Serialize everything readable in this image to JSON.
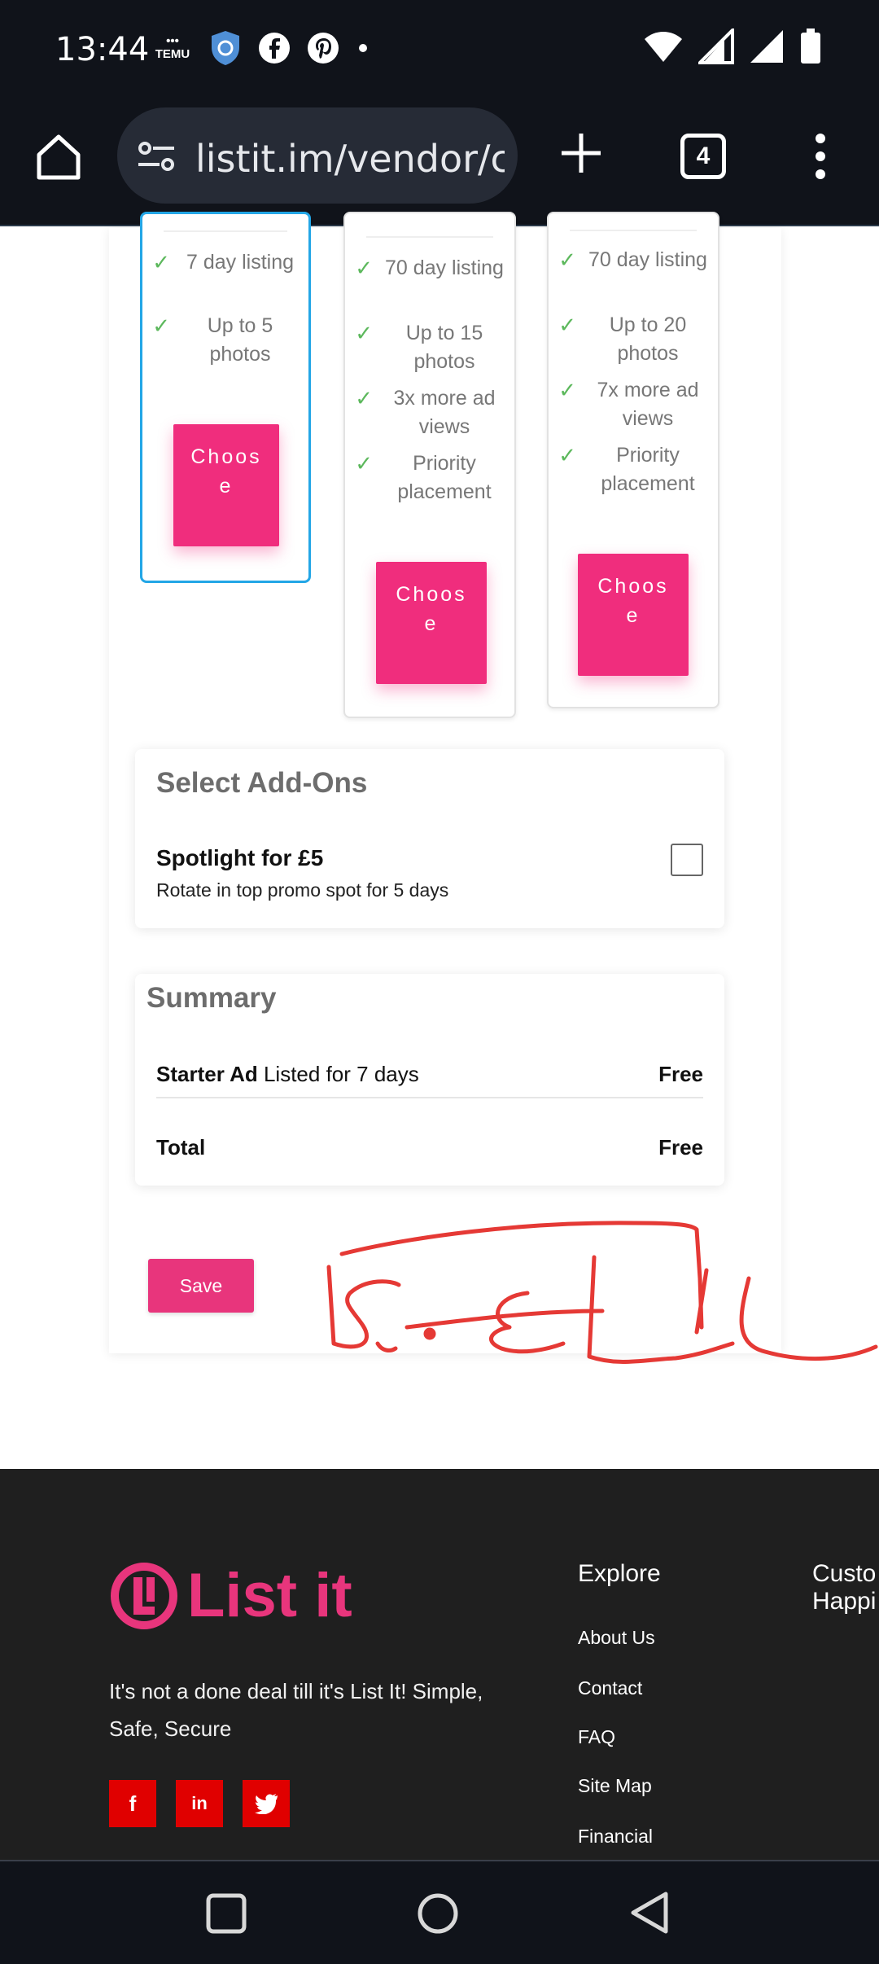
{
  "status_bar": {
    "time": "13:44",
    "temu_badge": "TEMU",
    "icons_left": [
      "temu-icon",
      "shield-icon",
      "facebook-icon",
      "pinterest-icon",
      "dot-icon"
    ],
    "icons_right": [
      "wifi-icon",
      "signal-icon",
      "signal-icon-2",
      "battery-icon"
    ]
  },
  "browser": {
    "url": "listit.im/vendor/c",
    "tab_count": "4"
  },
  "plans": [
    {
      "features": [
        "7 day listing",
        "Up to 5 photos"
      ],
      "button": "Choose",
      "selected": true
    },
    {
      "features": [
        "70 day listing",
        "Up to 15 photos",
        "3x more ad views",
        "Priority placement"
      ],
      "button": "Choose",
      "selected": false
    },
    {
      "features": [
        "70 day listing",
        "Up to 20 photos",
        "7x more ad views",
        "Priority placement"
      ],
      "button": "Choose",
      "selected": false
    }
  ],
  "addons": {
    "title": "Select Add-Ons",
    "spotlight_title": "Spotlight for £5",
    "spotlight_desc": "Rotate in top promo spot for 5 days",
    "spotlight_checked": false
  },
  "summary": {
    "title": "Summary",
    "item_name": "Starter Ad",
    "item_desc": "Listed for 7 days",
    "item_price": "Free",
    "total_label": "Total",
    "total_value": "Free"
  },
  "save_label": "Save",
  "annotation_text": "SELL",
  "footer": {
    "logo_text": "List it",
    "tagline": "It's not a done deal till it's List It! Simple, Safe, Secure",
    "socials": [
      "f",
      "in",
      "t"
    ],
    "explore_heading": "Explore",
    "explore_links": [
      "About Us",
      "Contact",
      "FAQ",
      "Site Map",
      "Financial"
    ],
    "customer_heading_line1": "Custo",
    "customer_heading_line2": "Happi"
  },
  "colors": {
    "accent_pink": "#f02d7d",
    "selected_border": "#23a6e6",
    "check_green": "#5cb85c",
    "footer_bg": "#1f1f1f",
    "social_red": "#e00000",
    "scribble_red": "#e53935"
  }
}
